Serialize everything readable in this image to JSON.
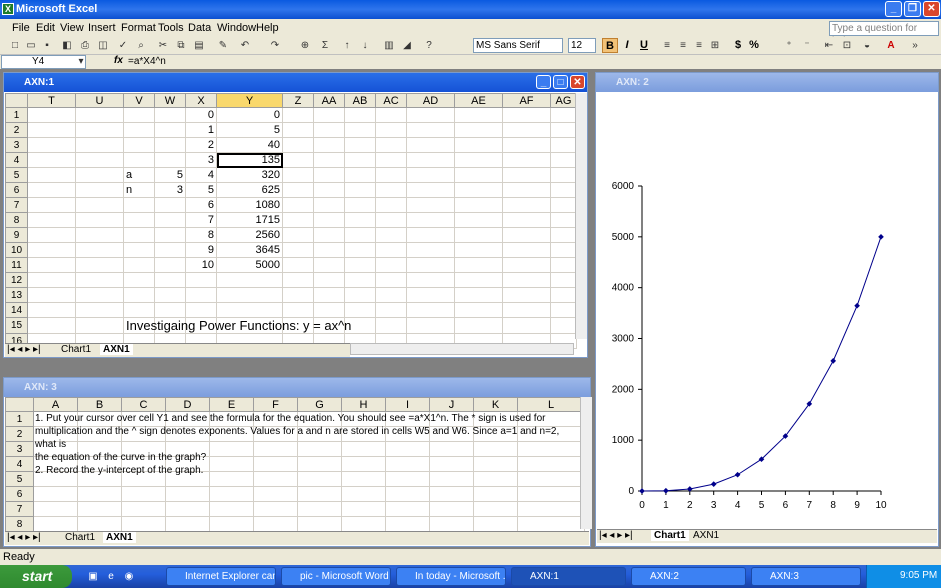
{
  "app": {
    "title": "Microsoft Excel",
    "ask_placeholder": "Type a question for help"
  },
  "menu": [
    "File",
    "Edit",
    "View",
    "Insert",
    "Format",
    "Tools",
    "Data",
    "Window",
    "Help"
  ],
  "toolbar": {
    "font": "MS Sans Serif",
    "size": "12",
    "bold": "B",
    "italic": "I",
    "underline": "U",
    "currency": "$",
    "percent": "%"
  },
  "formula_bar": {
    "cell": "Y4",
    "fx": "fx",
    "formula": "=a*X4^n"
  },
  "win1": {
    "title": "AXN:1",
    "columns": [
      "T",
      "U",
      "V",
      "W",
      "X",
      "Y",
      "Z",
      "AA",
      "AB",
      "AC",
      "AD",
      "AE",
      "AF",
      "AG"
    ],
    "rows": [
      {
        "r": "1",
        "V": "",
        "W": "",
        "X": "0",
        "Y": "0"
      },
      {
        "r": "2",
        "V": "",
        "W": "",
        "X": "1",
        "Y": "5"
      },
      {
        "r": "3",
        "V": "",
        "W": "",
        "X": "2",
        "Y": "40"
      },
      {
        "r": "4",
        "V": "",
        "W": "",
        "X": "3",
        "Y": "135"
      },
      {
        "r": "5",
        "V": "a",
        "W": "5",
        "X": "4",
        "Y": "320"
      },
      {
        "r": "6",
        "V": "n",
        "W": "3",
        "X": "5",
        "Y": "625"
      },
      {
        "r": "7",
        "V": "",
        "W": "",
        "X": "6",
        "Y": "1080"
      },
      {
        "r": "8",
        "V": "",
        "W": "",
        "X": "7",
        "Y": "1715"
      },
      {
        "r": "9",
        "V": "",
        "W": "",
        "X": "8",
        "Y": "2560"
      },
      {
        "r": "10",
        "V": "",
        "W": "",
        "X": "9",
        "Y": "3645"
      },
      {
        "r": "11",
        "V": "",
        "W": "",
        "X": "10",
        "Y": "5000"
      },
      {
        "r": "12",
        "V": "",
        "W": "",
        "X": "",
        "Y": ""
      },
      {
        "r": "13",
        "V": "",
        "W": "",
        "X": "",
        "Y": ""
      },
      {
        "r": "14",
        "V": "",
        "W": "",
        "X": "",
        "Y": ""
      },
      {
        "r": "15",
        "V": "",
        "W": "",
        "X": "",
        "Y": ""
      },
      {
        "r": "16",
        "V": "",
        "W": "",
        "X": "",
        "Y": ""
      }
    ],
    "heading": "Investigaing Power Functions: y = ax^n",
    "tabs": [
      "Chart1",
      "AXN1"
    ]
  },
  "win2": {
    "title": "AXN: 2",
    "tabs": [
      "Chart1",
      "AXN1"
    ]
  },
  "win3": {
    "title": "AXN: 3",
    "columns": [
      "A",
      "B",
      "C",
      "D",
      "E",
      "F",
      "G",
      "H",
      "I",
      "J",
      "K",
      "L"
    ],
    "row_numbers": [
      "1",
      "2",
      "3",
      "4",
      "5",
      "6",
      "7",
      "8"
    ],
    "text_lines": [
      "1. Put your cursor over cell Y1 and see the formula for the equation. You should see =a*X1^n. The * sign is used for",
      "multiplication and the ^ sign denotes exponents. Values for a and n are stored in cells W5 and W6. Since a=1 and n=2, what is",
      "the equation of the curve in the graph?",
      "2. Record the y-intercept of the graph."
    ],
    "tabs": [
      "Chart1",
      "AXN1"
    ]
  },
  "chart_data": {
    "type": "line",
    "x": [
      0,
      1,
      2,
      3,
      4,
      5,
      6,
      7,
      8,
      9,
      10
    ],
    "series": [
      {
        "values": [
          0,
          5,
          40,
          135,
          320,
          625,
          1080,
          1715,
          2560,
          3645,
          5000
        ]
      }
    ],
    "xlim": [
      0,
      10
    ],
    "ylim": [
      0,
      6000
    ],
    "yticks": [
      0,
      1000,
      2000,
      3000,
      4000,
      5000,
      6000
    ],
    "xticks": [
      0,
      1,
      2,
      3,
      4,
      5,
      6,
      7,
      8,
      9,
      10
    ],
    "title": "",
    "xlabel": "",
    "ylabel": "",
    "color": "#00008b"
  },
  "status": "Ready",
  "taskbar": {
    "start": "start",
    "buttons": [
      "Internet Explorer can...",
      "pic - Microsoft Word",
      "In today - Microsoft ...",
      "AXN:1",
      "AXN:2",
      "AXN:3"
    ],
    "time": "9:05 PM"
  }
}
